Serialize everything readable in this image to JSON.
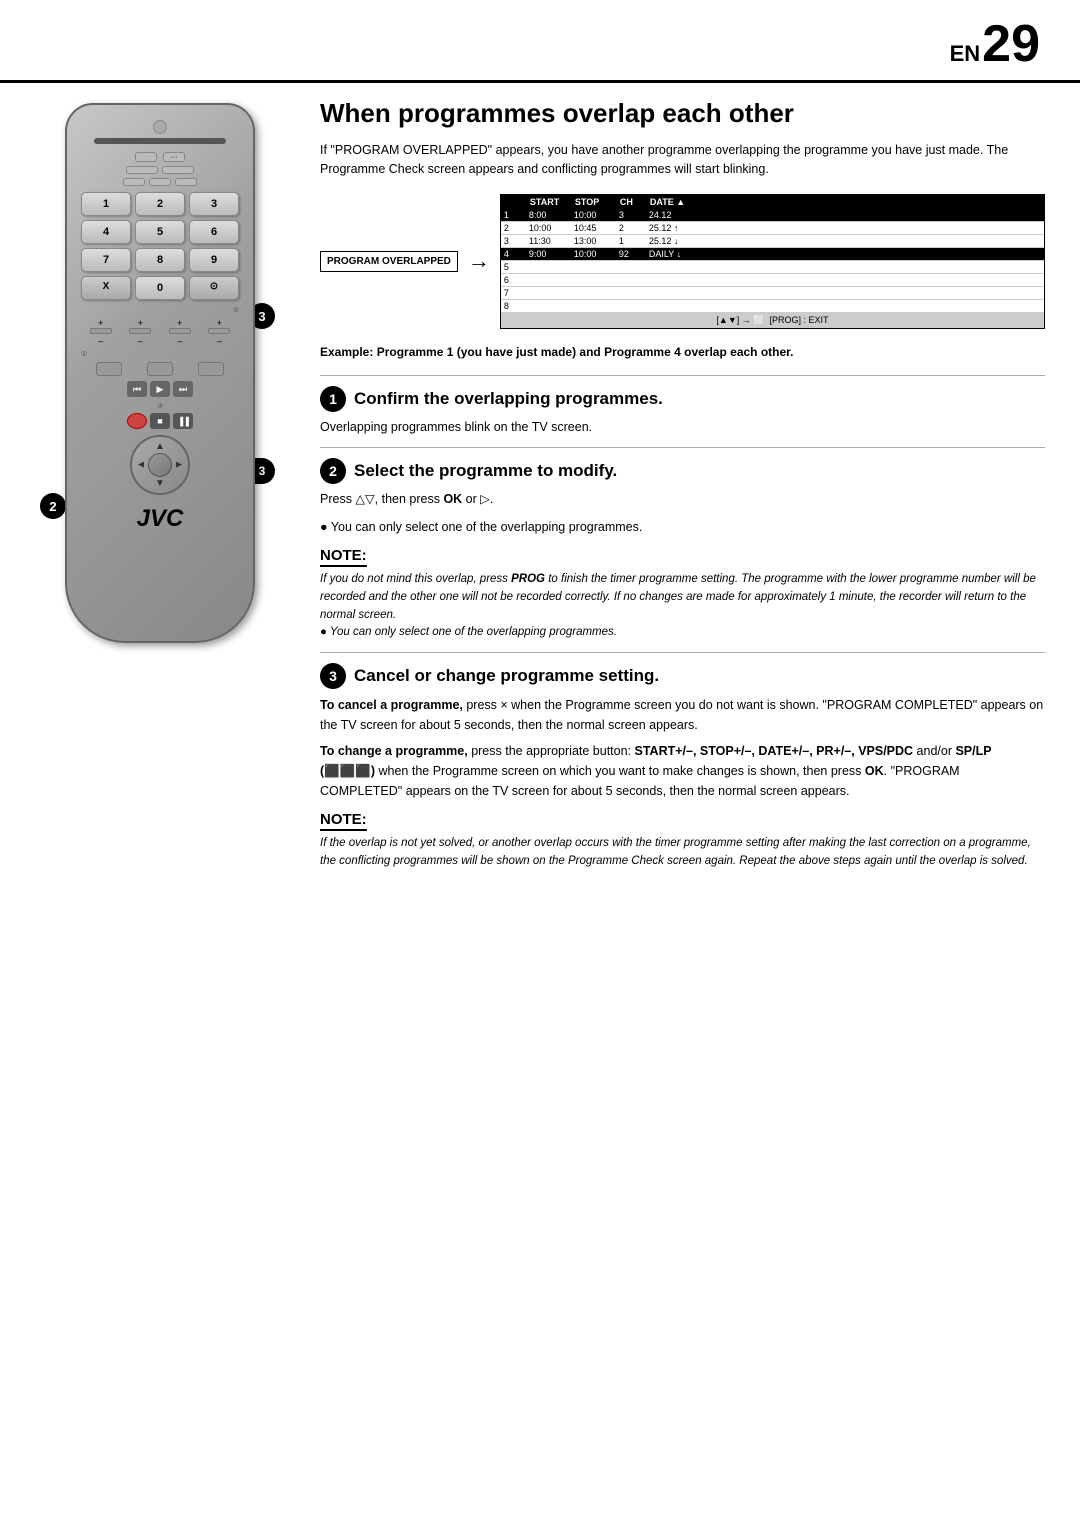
{
  "header": {
    "en_label": "EN",
    "page_number": "29"
  },
  "page_title": "When programmes overlap each other",
  "intro": "If \"PROGRAM OVERLAPPED\" appears, you have another programme overlapping the programme you have just made. The Programme Check screen appears and conflicting programmes will start blinking.",
  "program_screen": {
    "label": "PROGRAM OVERLAPPED",
    "table": {
      "headers": [
        "",
        "START",
        "STOP",
        "CH",
        "DATE"
      ],
      "rows": [
        {
          "num": "1",
          "start": "8:00",
          "stop": "10:00",
          "ch": "3",
          "date": "24.12",
          "highlight": true
        },
        {
          "num": "2",
          "start": "10:00",
          "stop": "10:45",
          "ch": "2",
          "date": "25.12"
        },
        {
          "num": "3",
          "start": "11:30",
          "stop": "13:00",
          "ch": "1",
          "date": "25.12"
        },
        {
          "num": "4",
          "start": "9:00",
          "stop": "10:00",
          "ch": "92",
          "date": "DAILY",
          "highlight": true
        },
        {
          "num": "5",
          "start": "",
          "stop": "",
          "ch": "",
          "date": ""
        },
        {
          "num": "6",
          "start": "",
          "stop": "",
          "ch": "",
          "date": ""
        },
        {
          "num": "7",
          "start": "",
          "stop": "",
          "ch": "",
          "date": ""
        },
        {
          "num": "8",
          "start": "",
          "stop": "",
          "ch": "",
          "date": ""
        }
      ],
      "footer": "[▲▼] → ⬜  [PROG] : EXIT"
    }
  },
  "example_text": "Example: Programme 1 (you have just made) and Programme 4 overlap each other.",
  "steps": [
    {
      "number": "1",
      "title": "Confirm the overlapping programmes.",
      "description": "Overlapping programmes blink on the TV screen."
    },
    {
      "number": "2",
      "title": "Select the programme to modify.",
      "description": "Press △▽, then press OK or ▷.",
      "bullet": "You can only select one of the overlapping programmes."
    },
    {
      "number": "3",
      "title": "Cancel or change programme setting.",
      "cancel_label": "To cancel a programme,",
      "cancel_text": "press × when the Programme screen you do not want is shown. \"PROGRAM COMPLETED\" appears on the TV screen for about 5 seconds, then the normal screen appears.",
      "change_label": "To change a programme,",
      "change_text": "press the appropriate button: START+/–, STOP+/–, DATE+/–, PR+/–, VPS/PDC and/or SP/LP (⬛⬛⬛) when the Programme screen on which you want to make changes is shown, then press OK. \"PROGRAM COMPLETED\" appears on the TV screen for about 5 seconds, then the normal screen appears."
    }
  ],
  "note1": {
    "label": "NOTE:",
    "text": "If you do not mind this overlap, press PROG to finish the timer programme setting. The programme with the lower programme number will be recorded and the other one will not be recorded correctly. If no changes are made for approximately 1 minute, the recorder will return to the normal screen."
  },
  "note2": {
    "label": "NOTE:",
    "text": "If the overlap is not yet solved, or another overlap occurs with the timer programme setting after making the last correction on a programme, the conflicting programmes will be shown on the Programme Check screen again. Repeat the above steps again until the overlap is solved."
  },
  "remote": {
    "buttons": [
      "1",
      "2",
      "3",
      "4",
      "5",
      "6",
      "7",
      "8",
      "9"
    ],
    "special": [
      "X",
      "0",
      "⊙"
    ],
    "jvc_logo": "JVC"
  },
  "badges": {
    "badge3": "3",
    "badge23": "2 3",
    "badge2": "2"
  }
}
